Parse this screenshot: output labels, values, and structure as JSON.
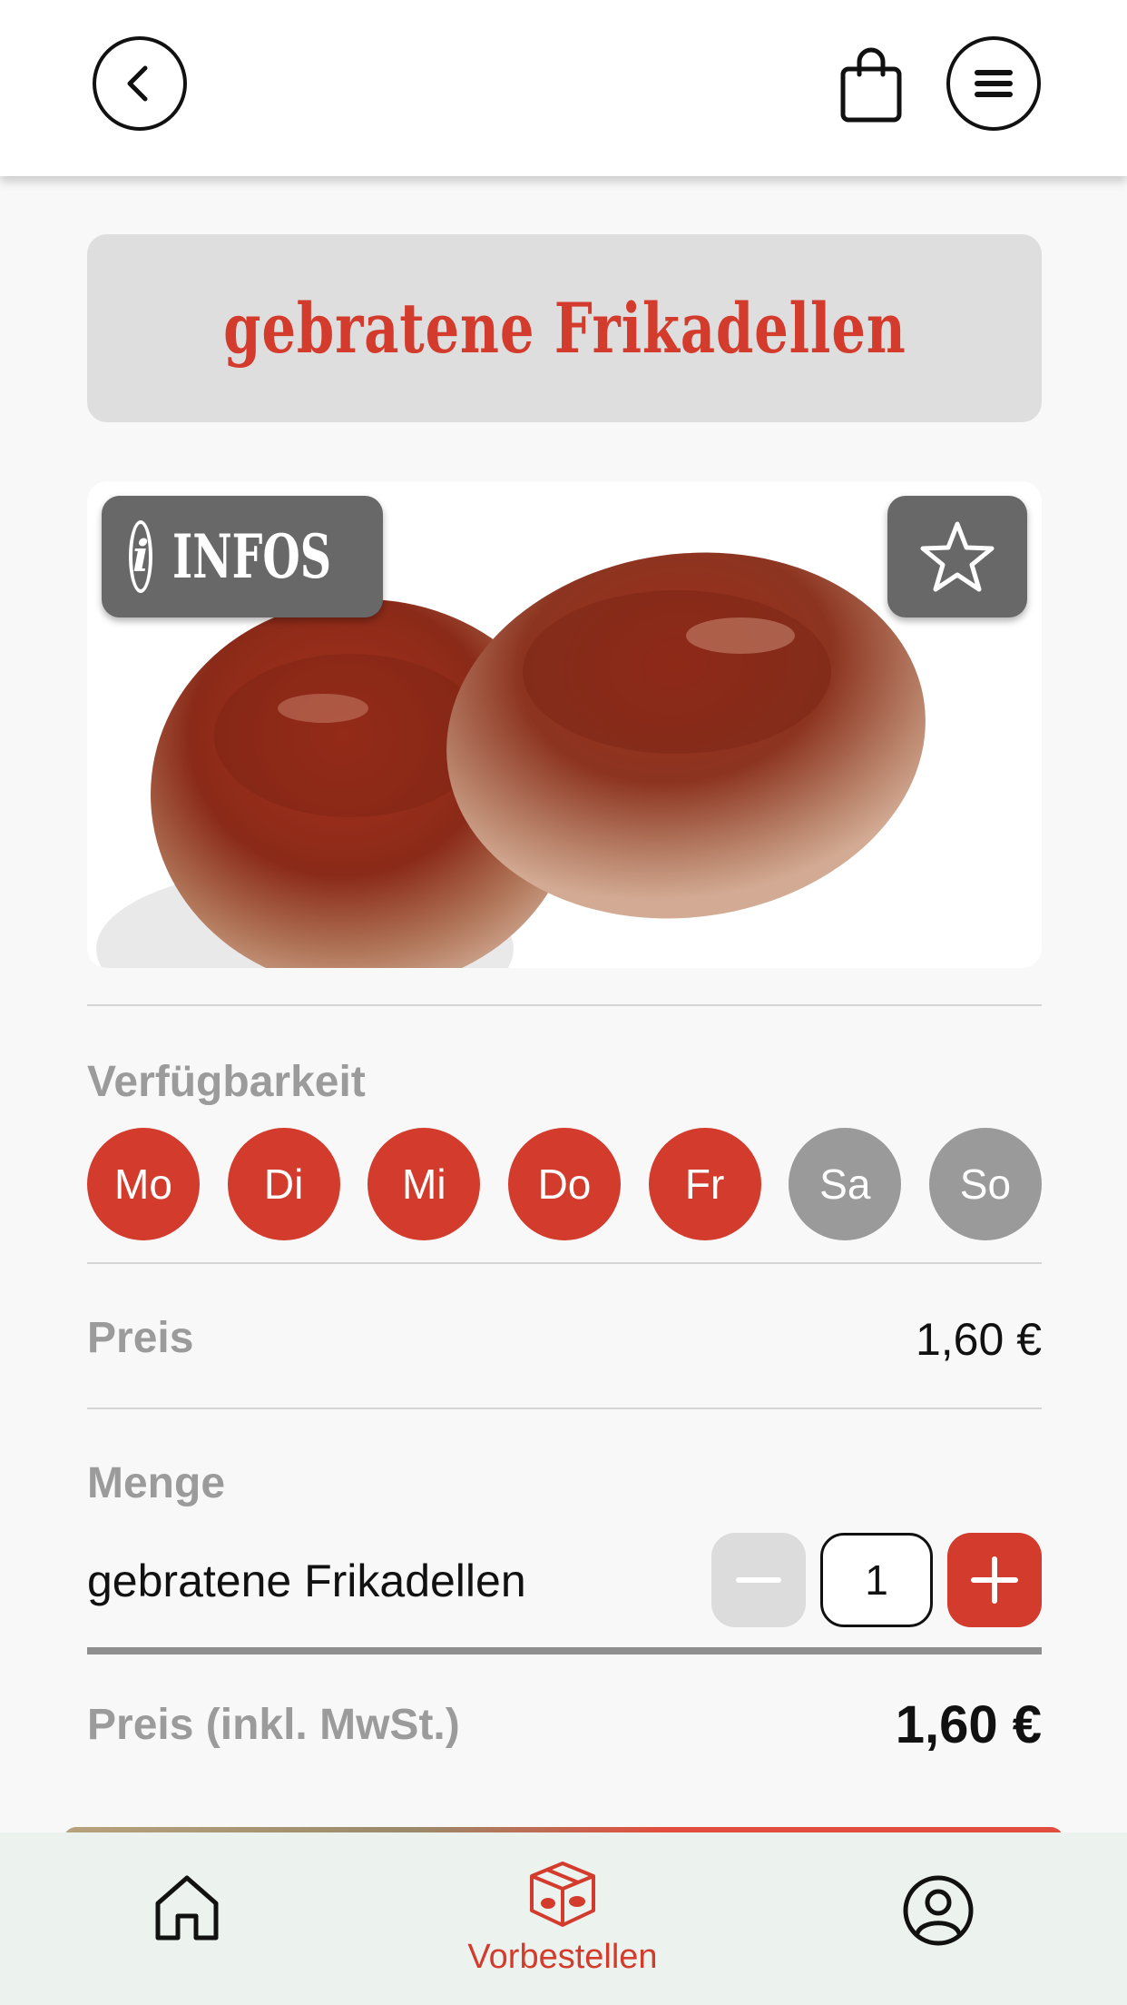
{
  "header": {
    "back_icon": "chevron-left-icon",
    "cart_icon": "shopping-bag-icon",
    "menu_icon": "hamburger-menu-icon"
  },
  "product": {
    "title": "gebratene Frikadellen",
    "infos_label": "INFOS",
    "info_icon": "info-icon",
    "favorite_icon": "star-icon"
  },
  "availability": {
    "label": "Verfügbarkeit",
    "days": [
      {
        "label": "Mo",
        "available": true
      },
      {
        "label": "Di",
        "available": true
      },
      {
        "label": "Mi",
        "available": true
      },
      {
        "label": "Do",
        "available": true
      },
      {
        "label": "Fr",
        "available": true
      },
      {
        "label": "Sa",
        "available": false
      },
      {
        "label": "So",
        "available": false
      }
    ]
  },
  "price": {
    "label": "Preis",
    "value": "1,60 €"
  },
  "quantity": {
    "label": "Menge",
    "item_name": "gebratene Frikadellen",
    "value": "1"
  },
  "total": {
    "label": "Preis (inkl. MwSt.)",
    "value": "1,60 €"
  },
  "tabbar": {
    "home_icon": "home-icon",
    "order_icon": "box-icon",
    "order_label": "Vorbestellen",
    "profile_icon": "user-icon"
  },
  "colors": {
    "accent": "#d33b2c",
    "inactive_day": "#9a9a9a",
    "tabbar_bg": "#ecf3ee"
  }
}
